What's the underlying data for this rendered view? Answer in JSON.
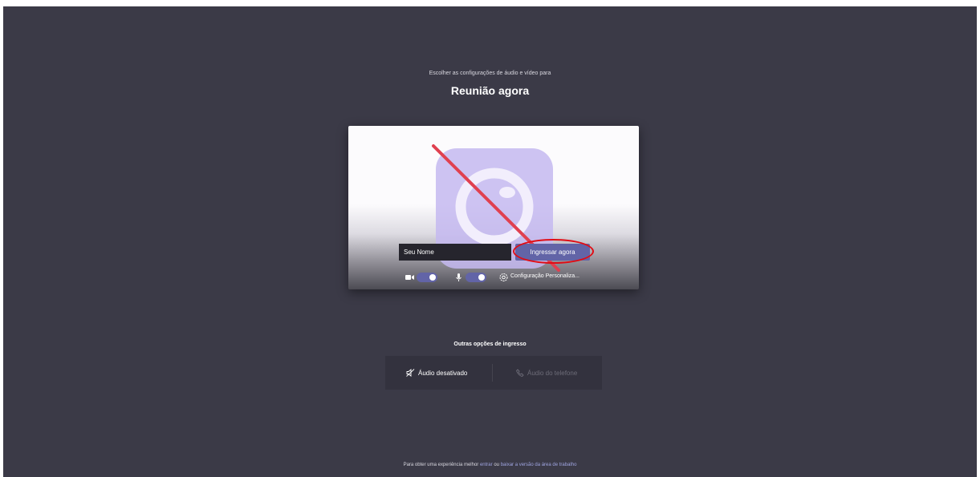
{
  "header": {
    "subtitle": "Escolher as configurações de áudio e vídeo para",
    "title": "Reunião agora"
  },
  "preview": {
    "name_placeholder": "Seu Nome",
    "join_label": "Ingressar agora",
    "camera_toggle_on": true,
    "mic_toggle_on": true,
    "settings_label": "Configuração Personaliza..."
  },
  "other_options": {
    "title": "Outras opções de ingresso",
    "audio_off_label": "Áudio desativado",
    "phone_audio_label": "Áudio do telefone"
  },
  "footer": {
    "prefix": "Para obter uma experiência melhor",
    "link_enter": "entrar",
    "or": "ou",
    "link_download": "baixar a versão da área de trabalho"
  },
  "colors": {
    "background": "#3b3a47",
    "accent": "#6264a7",
    "highlight": "#e10c14",
    "annotation": "#e04050"
  }
}
